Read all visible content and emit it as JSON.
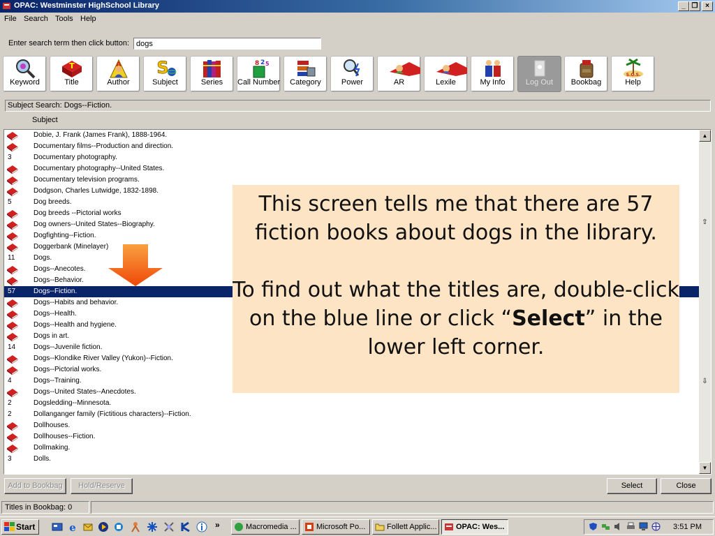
{
  "window": {
    "title": "OPAC: Westminster HighSchool Library"
  },
  "menu": [
    "File",
    "Search",
    "Tools",
    "Help"
  ],
  "search": {
    "label": "Enter search term then click button:",
    "value": "dogs"
  },
  "toolbar": [
    "Keyword",
    "Title",
    "Author",
    "Subject",
    "Series",
    "Call Number",
    "Category",
    "Power",
    "AR",
    "Lexile",
    "My Info",
    "Log Out",
    "Bookbag",
    "Help"
  ],
  "results": {
    "status": "Subject Search: Dogs--Fiction.",
    "column_header": "Subject",
    "rows": [
      {
        "count": "",
        "subject": "Dobie, J. Frank (James Frank), 1888-1964."
      },
      {
        "count": "",
        "subject": "Documentary films--Production and direction."
      },
      {
        "count": "3",
        "subject": "Documentary photography."
      },
      {
        "count": "",
        "subject": "Documentary photography--United States."
      },
      {
        "count": "",
        "subject": "Documentary television programs."
      },
      {
        "count": "",
        "subject": "Dodgson, Charles Lutwidge, 1832-1898."
      },
      {
        "count": "5",
        "subject": "Dog breeds."
      },
      {
        "count": "",
        "subject": "Dog breeds --Pictorial works"
      },
      {
        "count": "",
        "subject": "Dog owners--United States--Biography."
      },
      {
        "count": "",
        "subject": "Dogfighting--Fiction."
      },
      {
        "count": "",
        "subject": "Doggerbank (Minelayer)"
      },
      {
        "count": "11",
        "subject": "Dogs."
      },
      {
        "count": "",
        "subject": "Dogs--Anecotes."
      },
      {
        "count": "",
        "subject": "Dogs--Behavior."
      },
      {
        "count": "57",
        "subject": "Dogs--Fiction."
      },
      {
        "count": "",
        "subject": "Dogs--Habits and behavior."
      },
      {
        "count": "",
        "subject": "Dogs--Health."
      },
      {
        "count": "",
        "subject": "Dogs--Health and hygiene."
      },
      {
        "count": "",
        "subject": "Dogs in art."
      },
      {
        "count": "14",
        "subject": "Dogs--Juvenile fiction."
      },
      {
        "count": "",
        "subject": "Dogs--Klondike River Valley (Yukon)--Fiction."
      },
      {
        "count": "",
        "subject": "Dogs--Pictorial works."
      },
      {
        "count": "4",
        "subject": "Dogs--Training."
      },
      {
        "count": "",
        "subject": "Dogs--United States--Anecdotes."
      },
      {
        "count": "2",
        "subject": "Dogsledding--Minnesota."
      },
      {
        "count": "2",
        "subject": "Dollanganger family (Fictitious characters)--Fiction."
      },
      {
        "count": "",
        "subject": "Dollhouses."
      },
      {
        "count": "",
        "subject": "Dollhouses--Fiction."
      },
      {
        "count": "",
        "subject": "Dollmaking."
      },
      {
        "count": "3",
        "subject": "Dolls."
      }
    ],
    "selected_index": 14
  },
  "callout": {
    "line1": "This screen tells me that there are 57 fiction books about dogs in the library.",
    "line2_before": "To find out what the titles are, double-click on the blue line or click “",
    "line2_bold": "Select",
    "line2_after": "” in the lower left corner."
  },
  "buttons": {
    "add_to_bookbag": "Add to Bookbag",
    "hold_reserve": "Hold/Reserve",
    "select": "Select",
    "close": "Close"
  },
  "statusbar": {
    "bookbag": "Titles in Bookbag:  0"
  },
  "taskbar": {
    "start": "Start",
    "tasks": [
      "Macromedia ...",
      "Microsoft Po...",
      "Follett Applic...",
      "OPAC: Wes..."
    ],
    "clock": "3:51 PM"
  },
  "colors": {
    "selection": "#0a246a",
    "callout_bg": "#fce4c4",
    "arrow": "#f26a0a"
  }
}
